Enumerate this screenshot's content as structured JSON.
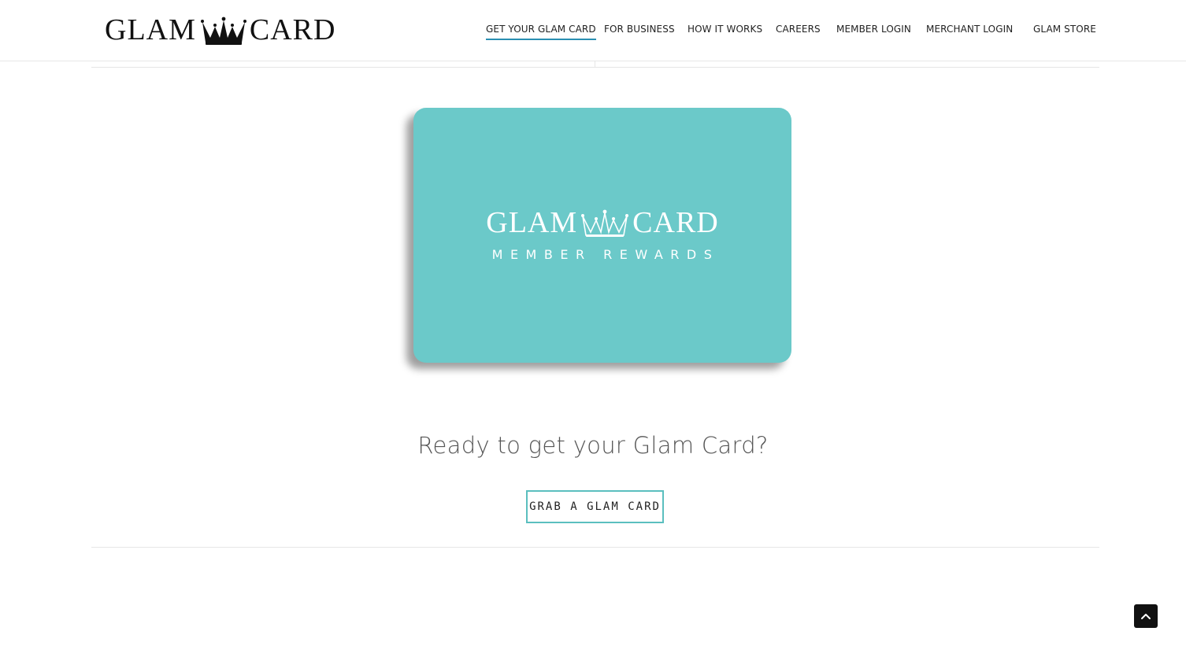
{
  "header": {
    "logo": {
      "left_text": "GLAM",
      "right_text": "CARD",
      "icon": "crown-icon"
    },
    "nav": [
      {
        "label": "GET YOUR GLAM CARD",
        "active": true
      },
      {
        "label": "FOR BUSINESS",
        "active": false
      },
      {
        "label": "HOW IT WORKS",
        "active": false
      },
      {
        "label": "CAREERS",
        "active": false
      },
      {
        "label": "MEMBER LOGIN",
        "active": false
      },
      {
        "label": "MERCHANT LOGIN",
        "active": false
      },
      {
        "label": "GLAM STORE",
        "active": false
      }
    ],
    "active_underline_color": "#2a8fb2"
  },
  "card": {
    "logo_left": "GLAM",
    "logo_right": "CARD",
    "subtitle": "MEMBER REWARDS",
    "background_color": "#6bc9c9"
  },
  "cta": {
    "heading": "Ready to get your Glam Card?",
    "button_label": "GRAB A GLAM CARD",
    "button_border_color": "#5bbfbf"
  },
  "back_to_top": {
    "icon": "chevron-up-icon"
  }
}
